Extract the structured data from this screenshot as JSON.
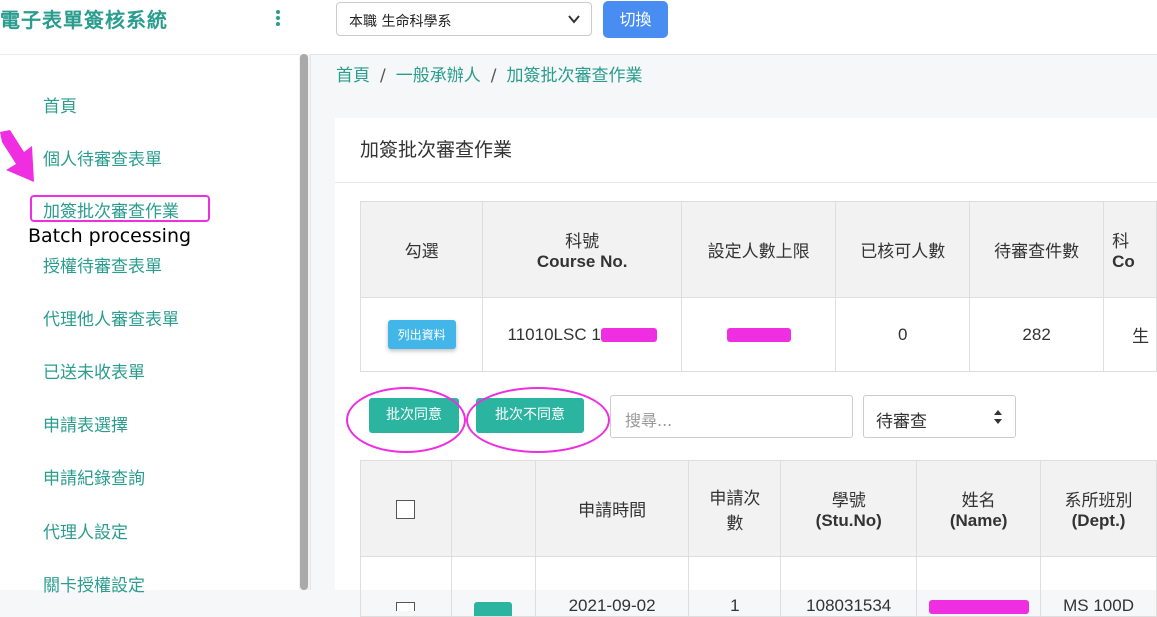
{
  "sidebar": {
    "brand": "電子表單簽核系統",
    "items": [
      {
        "label": "首頁"
      },
      {
        "label": "個人待審查表單"
      },
      {
        "label": "加簽批次審查作業"
      },
      {
        "label": "授權待審查表單"
      },
      {
        "label": "代理他人審查表單"
      },
      {
        "label": "已送未收表單"
      },
      {
        "label": "申請表選擇"
      },
      {
        "label": "申請紀錄查詢"
      },
      {
        "label": "代理人設定"
      },
      {
        "label": "關卡授權設定"
      }
    ],
    "annotation": "Batch processing"
  },
  "topbar": {
    "role_select": "本職 生命科學系",
    "switch_label": "切換"
  },
  "breadcrumb": [
    "首頁",
    "一般承辦人",
    "加簽批次審查作業"
  ],
  "card": {
    "title": "加簽批次審查作業"
  },
  "course_table": {
    "headers": {
      "select": "勾選",
      "course_zh": "科號",
      "course_en": "Course No.",
      "limit": "設定人數上限",
      "approved": "已核可人數",
      "pending": "待審查件數",
      "next_zh": "科",
      "next_en": "Co"
    },
    "row": {
      "list_button": "列出資料",
      "course_no": "11010LSC 1",
      "approved": "0",
      "pending": "282",
      "next": "生"
    }
  },
  "actions": {
    "approve_all": "批次同意",
    "reject_all": "批次不同意",
    "search_placeholder": "搜尋...",
    "status_filter": "待審查"
  },
  "app_table": {
    "headers": {
      "time": "申請時間",
      "count_1": "申請次",
      "count_2": "數",
      "stu_zh": "學號",
      "stu_en": "(Stu.No)",
      "name_zh": "姓名",
      "name_en": "(Name)",
      "dept_zh": "系所班別",
      "dept_en": "(Dept.)"
    },
    "row": {
      "time": "2021-09-02",
      "count": "1",
      "stu_no": "108031534",
      "dept": "MS 100D"
    }
  },
  "colors": {
    "accent": "#2a9d8f",
    "highlight": "#ee2ee0",
    "primary": "#4a8df2",
    "action": "#2bb5a0"
  }
}
